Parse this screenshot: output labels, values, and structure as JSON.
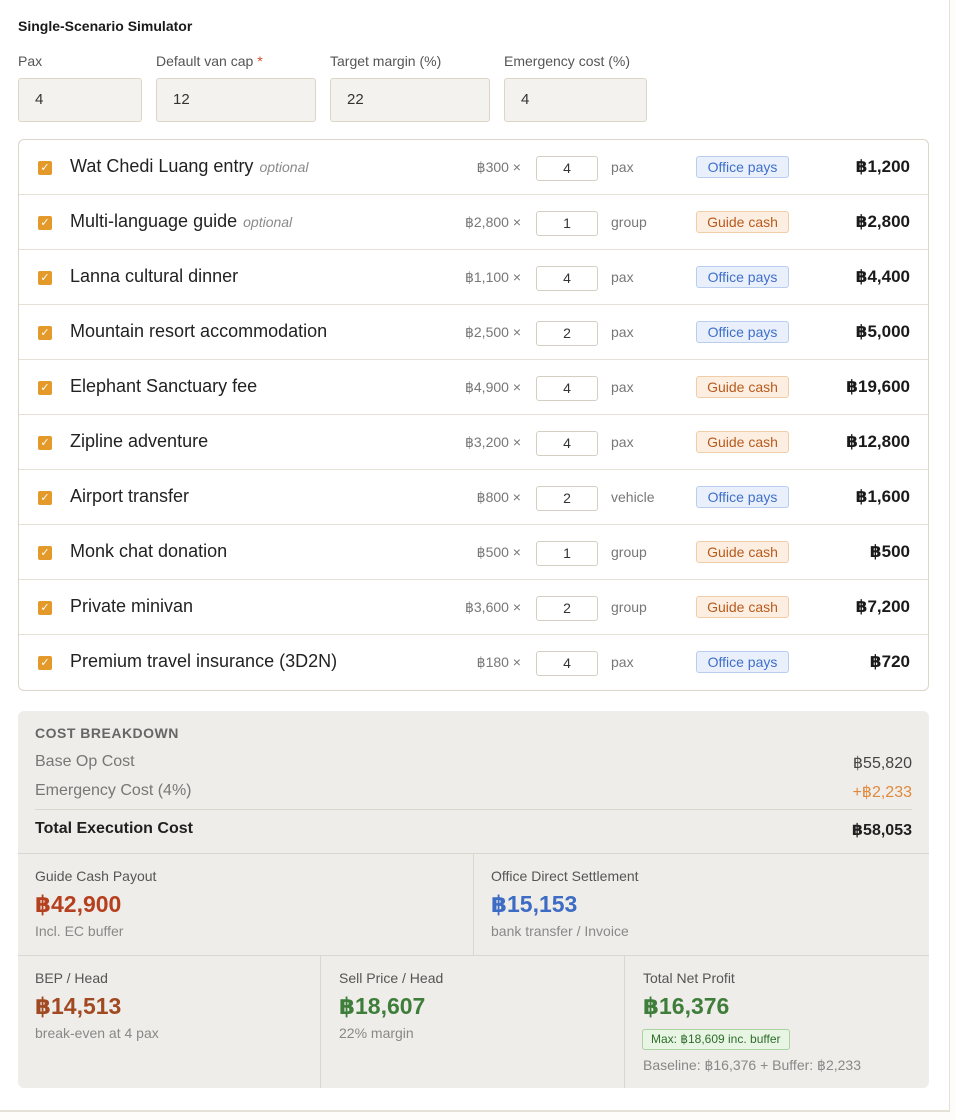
{
  "simulator": {
    "title": "Single-Scenario Simulator"
  },
  "fields": {
    "pax": {
      "label": "Pax",
      "value": "4"
    },
    "van_cap": {
      "label": "Default van cap",
      "required_mark": "*",
      "value": "12"
    },
    "target_margin": {
      "label": "Target margin (%)",
      "value": "22"
    },
    "emergency_cost": {
      "label": "Emergency cost (%)",
      "value": "4"
    }
  },
  "items": [
    {
      "checked": true,
      "name": "Wat Chedi Luang entry",
      "optional": "optional",
      "price": "฿300 ×",
      "qty": "4",
      "unit": "pax",
      "payer": "Office pays",
      "payer_type": "office",
      "total": "฿1,200"
    },
    {
      "checked": true,
      "name": "Multi-language guide",
      "optional": "optional",
      "price": "฿2,800 ×",
      "qty": "1",
      "unit": "group",
      "payer": "Guide cash",
      "payer_type": "guide",
      "total": "฿2,800"
    },
    {
      "checked": true,
      "name": "Lanna cultural dinner",
      "optional": "",
      "price": "฿1,100 ×",
      "qty": "4",
      "unit": "pax",
      "payer": "Office pays",
      "payer_type": "office",
      "total": "฿4,400"
    },
    {
      "checked": true,
      "name": "Mountain resort accommodation",
      "optional": "",
      "price": "฿2,500 ×",
      "qty": "2",
      "unit": "pax",
      "payer": "Office pays",
      "payer_type": "office",
      "total": "฿5,000"
    },
    {
      "checked": true,
      "name": "Elephant Sanctuary fee",
      "optional": "",
      "price": "฿4,900 ×",
      "qty": "4",
      "unit": "pax",
      "payer": "Guide cash",
      "payer_type": "guide",
      "total": "฿19,600"
    },
    {
      "checked": true,
      "name": "Zipline adventure",
      "optional": "",
      "price": "฿3,200 ×",
      "qty": "4",
      "unit": "pax",
      "payer": "Guide cash",
      "payer_type": "guide",
      "total": "฿12,800"
    },
    {
      "checked": true,
      "name": "Airport transfer",
      "optional": "",
      "price": "฿800 ×",
      "qty": "2",
      "unit": "vehicle",
      "payer": "Office pays",
      "payer_type": "office",
      "total": "฿1,600"
    },
    {
      "checked": true,
      "name": "Monk chat donation",
      "optional": "",
      "price": "฿500 ×",
      "qty": "1",
      "unit": "group",
      "payer": "Guide cash",
      "payer_type": "guide",
      "total": "฿500"
    },
    {
      "checked": true,
      "name": "Private minivan",
      "optional": "",
      "price": "฿3,600 ×",
      "qty": "2",
      "unit": "group",
      "payer": "Guide cash",
      "payer_type": "guide",
      "total": "฿7,200"
    },
    {
      "checked": true,
      "name": "Premium travel insurance (3D2N)",
      "optional": "",
      "price": "฿180 ×",
      "qty": "4",
      "unit": "pax",
      "payer": "Office pays",
      "payer_type": "office",
      "total": "฿720"
    }
  ],
  "breakdown": {
    "heading": "COST BREAKDOWN",
    "base_label": "Base Op Cost",
    "base_value": "฿55,820",
    "emergency_label": "Emergency Cost (4%)",
    "emergency_value": "+฿2,233",
    "total_label": "Total Execution Cost",
    "total_value": "฿58,053"
  },
  "payout": {
    "guide_label": "Guide Cash Payout",
    "guide_value": "฿42,900",
    "guide_sub": "Incl. EC buffer",
    "office_label": "Office Direct Settlement",
    "office_value": "฿15,153",
    "office_sub": "bank transfer / Invoice"
  },
  "pricing": {
    "bep_label": "BEP / Head",
    "bep_value": "฿14,513",
    "bep_sub": "break-even at 4 pax",
    "sell_label": "Sell Price / Head",
    "sell_value": "฿18,607",
    "sell_sub": "22% margin",
    "profit_label": "Total Net Profit",
    "profit_value": "฿16,376",
    "max_badge": "Max: ฿18,609 inc. buffer",
    "profit_sub": "Baseline: ฿16,376 + Buffer: ฿2,233"
  },
  "colors": {
    "accent": "#e39a2a",
    "office_badge": "#3f6fc9",
    "guide_badge": "#b85a1c",
    "guide_payout": "#b5401f",
    "office_settlement": "#3d6cc4",
    "bep": "#a14a22",
    "positive": "#3e7d3a"
  }
}
